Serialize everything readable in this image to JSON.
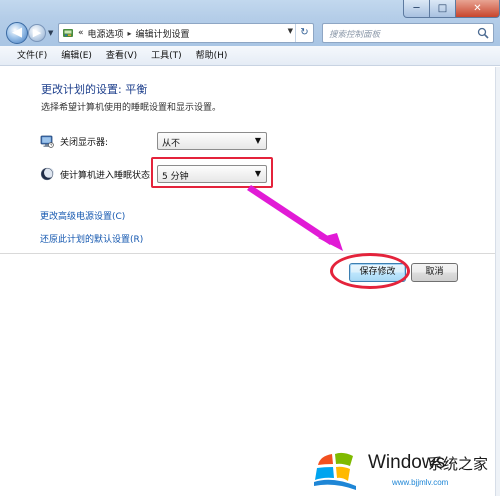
{
  "window": {
    "controls": {
      "minimize": "─",
      "maximize": "□",
      "close": "✕"
    }
  },
  "nav": {
    "back_icon": "back-arrow-icon",
    "forward_icon": "forward-arrow-icon",
    "back_glyph": "◀",
    "forward_glyph": "▶",
    "history_glyph": "▼"
  },
  "address": {
    "overflow": "«",
    "crumbs": [
      "电源选项",
      "编辑计划设置"
    ],
    "separator": "▸",
    "refresh_glyph": "↻"
  },
  "search": {
    "placeholder": "搜索控制面板"
  },
  "menu": {
    "items": [
      "文件(F)",
      "编辑(E)",
      "查看(V)",
      "工具(T)",
      "帮助(H)"
    ]
  },
  "page": {
    "title": "更改计划的设置: 平衡",
    "description": "选择希望计算机使用的睡眠设置和显示设置。"
  },
  "settings": {
    "display": {
      "label": "关闭显示器:",
      "value": "从不",
      "icon": "monitor-icon"
    },
    "sleep": {
      "label": "使计算机进入睡眠状态:",
      "value": "5 分钟",
      "icon": "moon-icon"
    }
  },
  "links": {
    "advanced": "更改高级电源设置(C)",
    "restore": "还原此计划的默认设置(R)"
  },
  "buttons": {
    "save": "保存修改",
    "cancel": "取消"
  },
  "annotations": {
    "color": "#e4233b",
    "arrow_color": "#e11bd6"
  },
  "watermark": {
    "brand": "Windows",
    "subtitle": "系统之家",
    "url": "www.bjjmlv.com"
  }
}
